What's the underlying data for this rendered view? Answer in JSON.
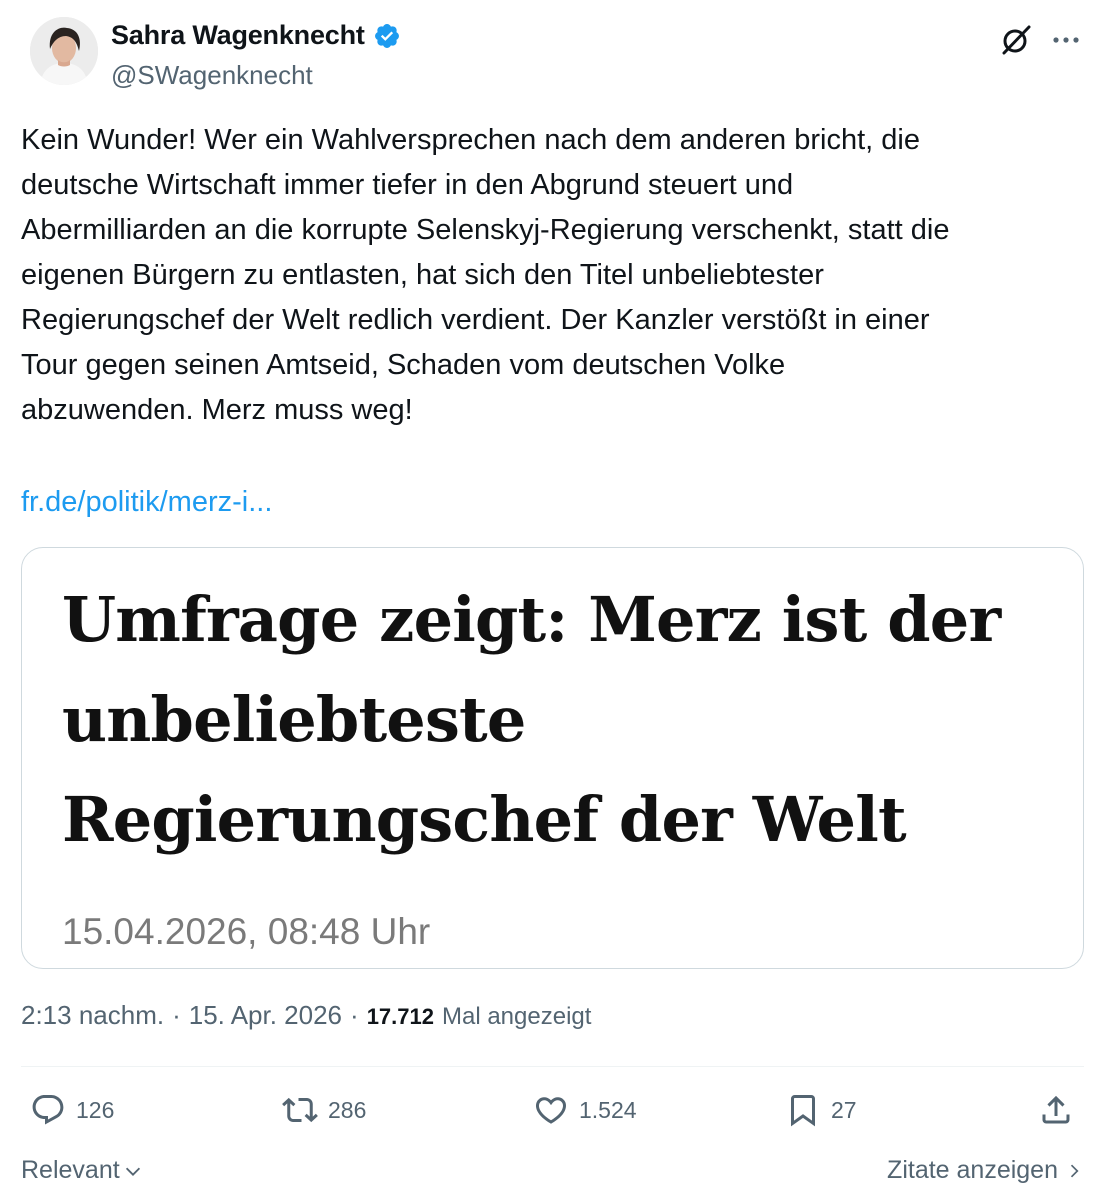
{
  "author": {
    "name": "Sahra Wagenknecht",
    "handle": "@SWagenknecht",
    "verified": true,
    "avatar_icon": "profile-photo"
  },
  "tweet": {
    "text": "Kein Wunder! Wer ein Wahlversprechen nach dem anderen bricht, die\ndeutsche Wirtschaft immer tiefer in den Abgrund steuert und\nAbermilliarden an die korrupte Selenskyj-Regierung verschenkt, statt die\neigenen Bürgern zu entlasten, hat sich den Titel unbeliebtester\nRegierungschef der Welt redlich verdient. Der Kanzler verstößt in einer\nTour gegen seinen Amtseid, Schaden vom deutschen Volke\nabzuwenden. Merz muss weg!",
    "link": "fr.de/politik/merz-i..."
  },
  "card": {
    "headline": "Umfrage zeigt: Merz ist der unbeliebteste Regierungschef der Welt",
    "date": "15.04.2026, 08:48 Uhr"
  },
  "meta": {
    "time": "2:13 nachm.",
    "separator": "·",
    "date": "15. Apr. 2026",
    "views_count": "17.712",
    "views_label": "Mal angezeigt"
  },
  "actions": {
    "replies": "126",
    "reposts": "286",
    "likes": "1.524",
    "bookmarks": "27"
  },
  "footer": {
    "sort_label": "Relevant",
    "quotes_label": "Zitate anzeigen"
  },
  "colors": {
    "link": "#1d9bf0",
    "secondary_text": "#536471",
    "verified_badge": "#1d9bf0",
    "border": "#cfd9de"
  }
}
